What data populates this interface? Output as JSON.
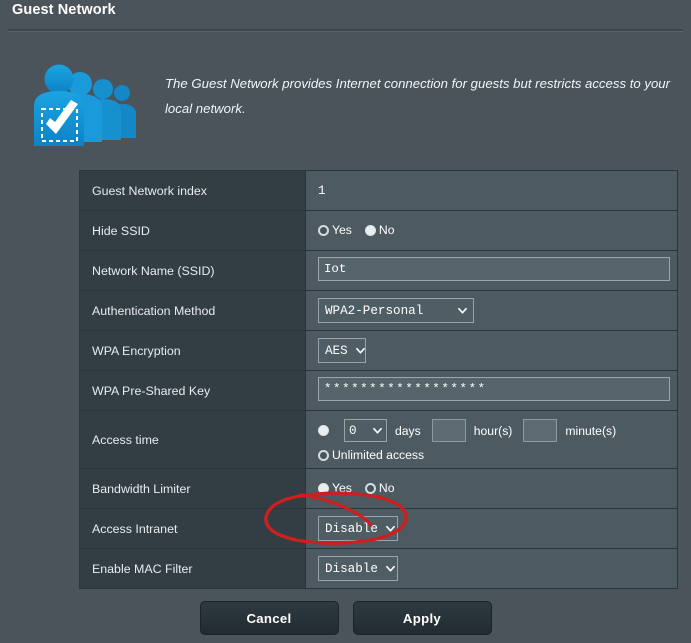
{
  "header": {
    "title": "Guest Network"
  },
  "intro": {
    "icon": "guest-users-icon",
    "description": "The Guest Network provides Internet connection for guests but restricts access to your local network."
  },
  "table": {
    "rows": [
      {
        "label": "Guest Network index",
        "type": "text",
        "value": "1"
      },
      {
        "label": "Hide SSID",
        "type": "radio",
        "options": [
          {
            "label": "Yes",
            "selected": false
          },
          {
            "label": "No",
            "selected": true
          }
        ]
      },
      {
        "label": "Network Name (SSID)",
        "type": "input",
        "value": "Iot",
        "placeholder": ""
      },
      {
        "label": "Authentication Method",
        "type": "select",
        "value": "WPA2-Personal"
      },
      {
        "label": "WPA Encryption",
        "type": "select",
        "value": "AES"
      },
      {
        "label": "WPA Pre-Shared Key",
        "type": "password",
        "value": "******************",
        "placeholder": ""
      },
      {
        "label": "Access time",
        "type": "access-time",
        "timed": {
          "selected": true,
          "days_value": "0",
          "days_label": "days",
          "hours_value": "",
          "hours_label": "hour(s)",
          "minutes_value": "",
          "minutes_label": "minute(s)"
        },
        "unlimited": {
          "selected": false,
          "label": "Unlimited access"
        }
      },
      {
        "label": "Bandwidth Limiter",
        "type": "radio",
        "options": [
          {
            "label": "Yes",
            "selected": true
          },
          {
            "label": "No",
            "selected": false
          }
        ]
      },
      {
        "label": "Access Intranet",
        "type": "select",
        "value": "Disable",
        "annotated": true
      },
      {
        "label": "Enable MAC Filter",
        "type": "select",
        "value": "Disable"
      }
    ]
  },
  "footer": {
    "cancel_label": "Cancel",
    "apply_label": "Apply"
  },
  "annotation": {
    "shape": "red-ellipse-highlight",
    "color": "#cc1f1f",
    "target": "Access Intranet"
  },
  "colors": {
    "page_bg": "#4b545b",
    "label_cell": "#323d44",
    "value_cell": "#4d5a61",
    "icon_blue": "#1b9bd8",
    "annotation_red": "#cc1f1f"
  }
}
